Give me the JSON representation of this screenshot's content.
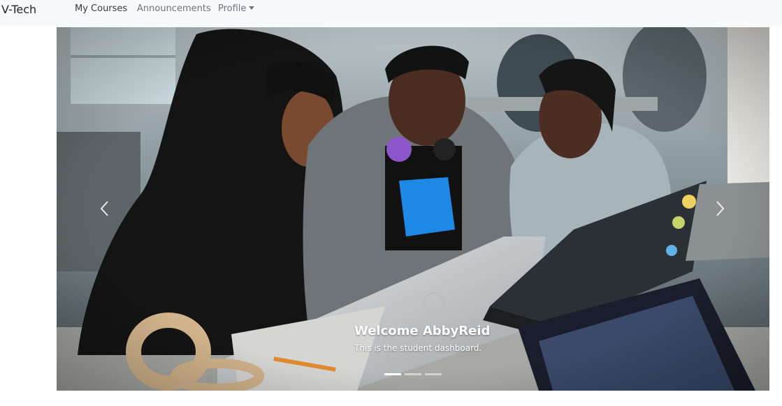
{
  "navbar": {
    "brand": "V-Tech",
    "links": [
      {
        "label": "My Courses"
      },
      {
        "label": "Announcements"
      },
      {
        "label": "Profile"
      }
    ]
  },
  "carousel": {
    "slide": {
      "title": "Welcome AbbyReid",
      "text": "This is the student dashboard."
    },
    "indicators": {
      "count": 3,
      "active_index": 0
    },
    "controls": {
      "prev_icon": "chevron-left-icon",
      "next_icon": "chevron-right-icon"
    }
  },
  "colors": {
    "navbar_bg": "#f8f9fa",
    "link_active": "#343a40",
    "link_muted": "#6c757d"
  }
}
